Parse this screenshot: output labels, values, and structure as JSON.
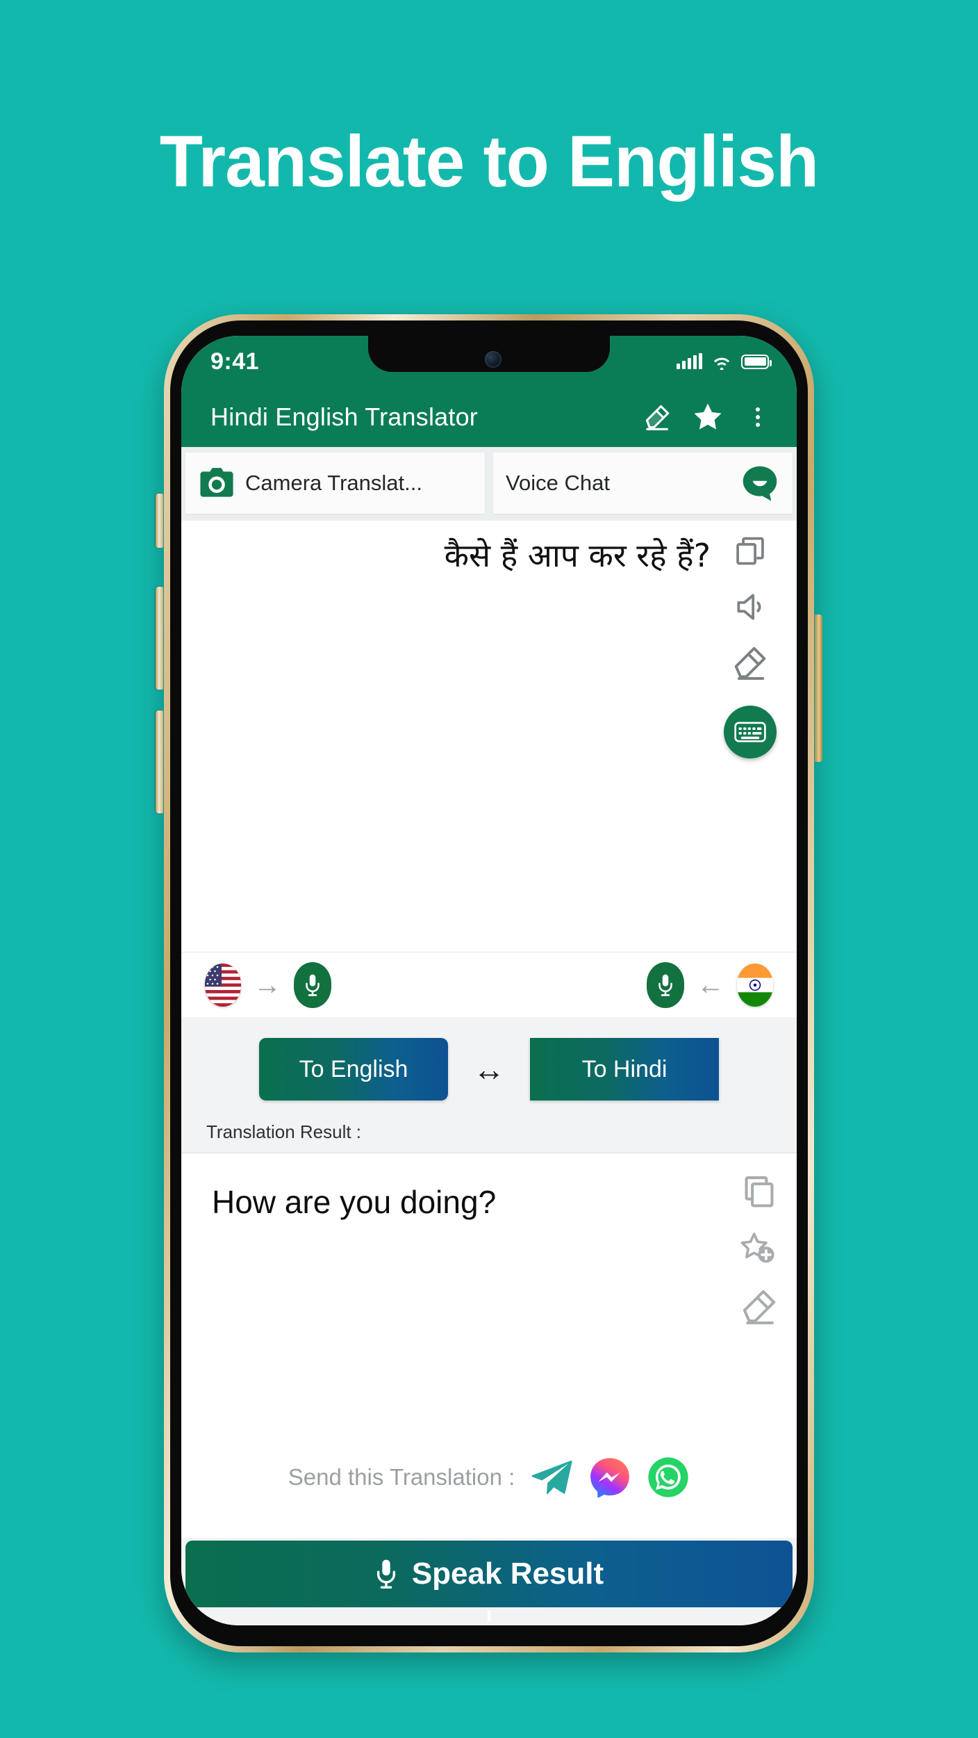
{
  "page": {
    "headline": "Translate to English",
    "background_color": "#13b8ac"
  },
  "phone": {
    "status_bar": {
      "time": "9:41",
      "signal_icon": "signal-bars-icon",
      "wifi_icon": "wifi-icon",
      "battery_icon": "battery-full-icon"
    },
    "app_bar": {
      "title": "Hindi English Translator",
      "actions": [
        {
          "icon": "eraser-icon",
          "label": "Clear"
        },
        {
          "icon": "star-icon",
          "label": "Favorites"
        },
        {
          "icon": "overflow-menu-icon",
          "label": "More options"
        }
      ]
    },
    "tabs": [
      {
        "label": "Camera Translat...",
        "icon": "camera-icon",
        "icon_side": "left"
      },
      {
        "label": "Voice Chat",
        "icon": "chat-bubble-icon",
        "icon_side": "right"
      }
    ],
    "source": {
      "text": "कैसे हैं  आप कर रहे हैं?",
      "tools": [
        {
          "icon": "copy-icon",
          "label": "Copy"
        },
        {
          "icon": "speaker-icon",
          "label": "Speak"
        },
        {
          "icon": "eraser-icon",
          "label": "Clear"
        }
      ],
      "keyboard_fab": {
        "icon": "keyboard-icon",
        "label": "Keyboard"
      }
    },
    "language_row": {
      "left": {
        "flag": "us-flag-icon",
        "arrow": "→",
        "mic": "microphone-icon"
      },
      "right": {
        "mic": "microphone-icon",
        "arrow": "←",
        "flag": "india-flag-icon"
      }
    },
    "translate_row": {
      "to_english_label": "To English",
      "swap_icon": "↔",
      "to_hindi_label": "To Hindi",
      "button_gradient_from": "#0a6e4f",
      "button_gradient_to": "#0d5291"
    },
    "result": {
      "label": "Translation Result :",
      "text": "How are you doing?",
      "tools": [
        {
          "icon": "copy-icon",
          "label": "Copy"
        },
        {
          "icon": "star-plus-icon",
          "label": "Add to favorites"
        },
        {
          "icon": "eraser-icon",
          "label": "Clear"
        }
      ],
      "send_label": "Send this Translation :",
      "send_targets": [
        {
          "icon": "telegram-icon",
          "label": "Telegram",
          "color": "#2aa8a0"
        },
        {
          "icon": "messenger-icon",
          "label": "Messenger",
          "color": "#a033f0"
        },
        {
          "icon": "whatsapp-icon",
          "label": "WhatsApp",
          "color": "#25d366"
        }
      ]
    },
    "speak_button": {
      "label": "Speak Result",
      "icon": "microphone-icon"
    }
  }
}
